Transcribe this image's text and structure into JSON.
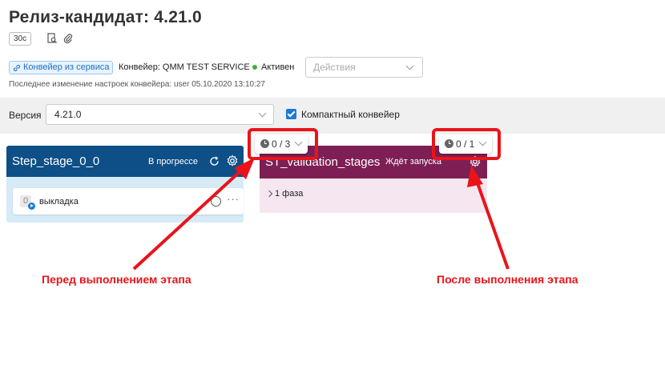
{
  "header": {
    "title": "Релиз-кандидат: 4.21.0",
    "tag": "30с"
  },
  "pipeline": {
    "source_badge": "Конвейер из сервиса",
    "name": "Конвейер: QMM TEST SERVICE",
    "status": "Активен",
    "actions_placeholder": "Действия",
    "last_change": "Последнее изменение настроек конвейера: user 05.10.2020 13:10:27"
  },
  "toolbar": {
    "version_label": "Версия",
    "version_value": "4.21.0",
    "compact_label": "Компактный конвейер",
    "compact_checked": true
  },
  "stages": [
    {
      "title": "Step_stage_0_0",
      "status": "В прогрессе",
      "color": "#0e4f87",
      "job": {
        "label": "выкладка",
        "icon_text": "0"
      }
    },
    {
      "title": "ST_validation_stages",
      "status": "Ждёт запуска",
      "color": "#7d1f54",
      "phase_label": "1 фаза",
      "counter": "0 / 1"
    }
  ],
  "counters": {
    "stage1": "0 / 3",
    "stage2": "0 / 1"
  },
  "annotations": {
    "before": "Перед выполнением этапа",
    "after": "После выполнения этапа",
    "color": "#e8141a"
  }
}
